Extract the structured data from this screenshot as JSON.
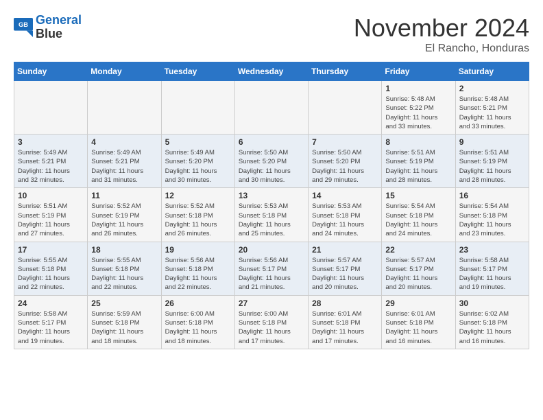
{
  "logo": {
    "line1": "General",
    "line2": "Blue"
  },
  "title": "November 2024",
  "subtitle": "El Rancho, Honduras",
  "days_of_week": [
    "Sunday",
    "Monday",
    "Tuesday",
    "Wednesday",
    "Thursday",
    "Friday",
    "Saturday"
  ],
  "weeks": [
    [
      {
        "day": "",
        "info": ""
      },
      {
        "day": "",
        "info": ""
      },
      {
        "day": "",
        "info": ""
      },
      {
        "day": "",
        "info": ""
      },
      {
        "day": "",
        "info": ""
      },
      {
        "day": "1",
        "info": "Sunrise: 5:48 AM\nSunset: 5:22 PM\nDaylight: 11 hours\nand 33 minutes."
      },
      {
        "day": "2",
        "info": "Sunrise: 5:48 AM\nSunset: 5:21 PM\nDaylight: 11 hours\nand 33 minutes."
      }
    ],
    [
      {
        "day": "3",
        "info": "Sunrise: 5:49 AM\nSunset: 5:21 PM\nDaylight: 11 hours\nand 32 minutes."
      },
      {
        "day": "4",
        "info": "Sunrise: 5:49 AM\nSunset: 5:21 PM\nDaylight: 11 hours\nand 31 minutes."
      },
      {
        "day": "5",
        "info": "Sunrise: 5:49 AM\nSunset: 5:20 PM\nDaylight: 11 hours\nand 30 minutes."
      },
      {
        "day": "6",
        "info": "Sunrise: 5:50 AM\nSunset: 5:20 PM\nDaylight: 11 hours\nand 30 minutes."
      },
      {
        "day": "7",
        "info": "Sunrise: 5:50 AM\nSunset: 5:20 PM\nDaylight: 11 hours\nand 29 minutes."
      },
      {
        "day": "8",
        "info": "Sunrise: 5:51 AM\nSunset: 5:19 PM\nDaylight: 11 hours\nand 28 minutes."
      },
      {
        "day": "9",
        "info": "Sunrise: 5:51 AM\nSunset: 5:19 PM\nDaylight: 11 hours\nand 28 minutes."
      }
    ],
    [
      {
        "day": "10",
        "info": "Sunrise: 5:51 AM\nSunset: 5:19 PM\nDaylight: 11 hours\nand 27 minutes."
      },
      {
        "day": "11",
        "info": "Sunrise: 5:52 AM\nSunset: 5:19 PM\nDaylight: 11 hours\nand 26 minutes."
      },
      {
        "day": "12",
        "info": "Sunrise: 5:52 AM\nSunset: 5:18 PM\nDaylight: 11 hours\nand 26 minutes."
      },
      {
        "day": "13",
        "info": "Sunrise: 5:53 AM\nSunset: 5:18 PM\nDaylight: 11 hours\nand 25 minutes."
      },
      {
        "day": "14",
        "info": "Sunrise: 5:53 AM\nSunset: 5:18 PM\nDaylight: 11 hours\nand 24 minutes."
      },
      {
        "day": "15",
        "info": "Sunrise: 5:54 AM\nSunset: 5:18 PM\nDaylight: 11 hours\nand 24 minutes."
      },
      {
        "day": "16",
        "info": "Sunrise: 5:54 AM\nSunset: 5:18 PM\nDaylight: 11 hours\nand 23 minutes."
      }
    ],
    [
      {
        "day": "17",
        "info": "Sunrise: 5:55 AM\nSunset: 5:18 PM\nDaylight: 11 hours\nand 22 minutes."
      },
      {
        "day": "18",
        "info": "Sunrise: 5:55 AM\nSunset: 5:18 PM\nDaylight: 11 hours\nand 22 minutes."
      },
      {
        "day": "19",
        "info": "Sunrise: 5:56 AM\nSunset: 5:18 PM\nDaylight: 11 hours\nand 22 minutes."
      },
      {
        "day": "20",
        "info": "Sunrise: 5:56 AM\nSunset: 5:17 PM\nDaylight: 11 hours\nand 21 minutes."
      },
      {
        "day": "21",
        "info": "Sunrise: 5:57 AM\nSunset: 5:17 PM\nDaylight: 11 hours\nand 20 minutes."
      },
      {
        "day": "22",
        "info": "Sunrise: 5:57 AM\nSunset: 5:17 PM\nDaylight: 11 hours\nand 20 minutes."
      },
      {
        "day": "23",
        "info": "Sunrise: 5:58 AM\nSunset: 5:17 PM\nDaylight: 11 hours\nand 19 minutes."
      }
    ],
    [
      {
        "day": "24",
        "info": "Sunrise: 5:58 AM\nSunset: 5:17 PM\nDaylight: 11 hours\nand 19 minutes."
      },
      {
        "day": "25",
        "info": "Sunrise: 5:59 AM\nSunset: 5:18 PM\nDaylight: 11 hours\nand 18 minutes."
      },
      {
        "day": "26",
        "info": "Sunrise: 6:00 AM\nSunset: 5:18 PM\nDaylight: 11 hours\nand 18 minutes."
      },
      {
        "day": "27",
        "info": "Sunrise: 6:00 AM\nSunset: 5:18 PM\nDaylight: 11 hours\nand 17 minutes."
      },
      {
        "day": "28",
        "info": "Sunrise: 6:01 AM\nSunset: 5:18 PM\nDaylight: 11 hours\nand 17 minutes."
      },
      {
        "day": "29",
        "info": "Sunrise: 6:01 AM\nSunset: 5:18 PM\nDaylight: 11 hours\nand 16 minutes."
      },
      {
        "day": "30",
        "info": "Sunrise: 6:02 AM\nSunset: 5:18 PM\nDaylight: 11 hours\nand 16 minutes."
      }
    ]
  ]
}
